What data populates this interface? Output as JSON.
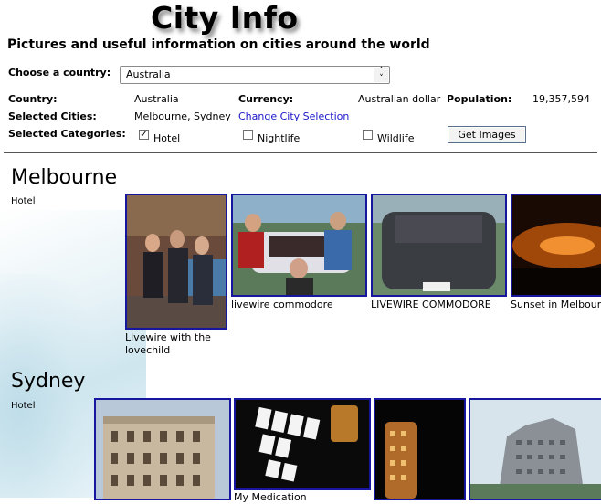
{
  "header": {
    "title": "City Info",
    "subtitle": "Pictures and useful information on cities around the world"
  },
  "country_chooser": {
    "label": "Choose a country:",
    "selected": "Australia"
  },
  "info": {
    "country_label": "Country:",
    "country_value": "Australia",
    "currency_label": "Currency:",
    "currency_value": "Australian dollar",
    "population_label": "Population:",
    "population_value": "19,357,594",
    "selected_cities_label": "Selected Cities:",
    "selected_cities_value": "Melbourne, Sydney",
    "change_city_link": "Change City Selection",
    "selected_categories_label": "Selected Categories:"
  },
  "categories": [
    {
      "label": "Hotel",
      "checked": true
    },
    {
      "label": "Nightlife",
      "checked": false
    },
    {
      "label": "Wildlife",
      "checked": false
    }
  ],
  "get_images_label": "Get Images",
  "cities": [
    {
      "name": "Melbourne",
      "category": "Hotel",
      "images": [
        {
          "caption": "Livewire with the lovechild"
        },
        {
          "caption": "livewire commodore"
        },
        {
          "caption": "LIVEWIRE COMMODORE"
        },
        {
          "caption": "Sunset in Melbourne"
        }
      ]
    },
    {
      "name": "Sydney",
      "category": "Hotel",
      "images": [
        {
          "caption": ""
        },
        {
          "caption": "My Medication"
        },
        {
          "caption": ""
        },
        {
          "caption": ""
        }
      ]
    }
  ],
  "colors": {
    "link": "#1a16c8",
    "thumb_border": "#16169e",
    "divider": "#555555"
  }
}
